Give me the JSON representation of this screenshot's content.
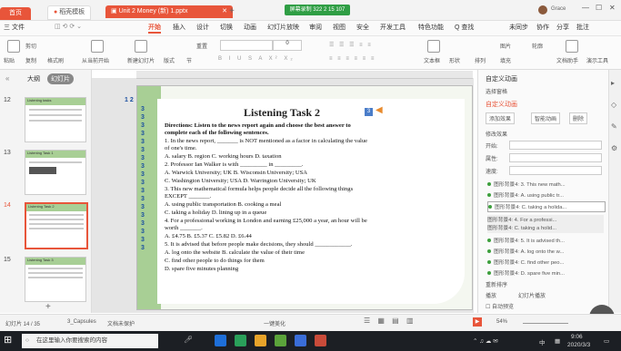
{
  "titlebar": {
    "home_tab": "首页",
    "template_tab": "稻壳模板",
    "doc_tab": "Unit 2 Money (新) 1.pptx",
    "timer": "屏幕录制 322 2 15 107",
    "user": "Grace"
  },
  "menu": {
    "items": [
      "三 文件",
      "开始",
      "插入",
      "设计",
      "切换",
      "动画",
      "幻灯片放映",
      "审阅",
      "视图",
      "安全",
      "开发工具",
      "特色功能",
      "Q 查找"
    ],
    "right": [
      "未同步",
      "协作",
      "分享",
      "批注"
    ]
  },
  "ribbon": {
    "left_buttons": [
      "粘贴",
      "剪切",
      "复制",
      "格式刷",
      "从当前开始",
      "新建幻灯片",
      "版式",
      "节",
      "重置"
    ],
    "font_size": "0",
    "right_buttons": [
      "文本框",
      "形状",
      "排列",
      "图片",
      "填充",
      "轮廓",
      "文档助手",
      "演示工具"
    ]
  },
  "left_panel": {
    "tabs": [
      "大纲",
      "幻灯片"
    ],
    "slide_numbers": [
      "12",
      "13",
      "14",
      "15"
    ],
    "thumb_titles": [
      "Listening tasks",
      "Listening Task 1",
      "Listening Task 2",
      "Listening Task 3"
    ],
    "add_notes": "单击此处添加备注"
  },
  "slide": {
    "number_tag": "1 2",
    "title": "Listening Task 2",
    "badge": "3",
    "lines": [
      "Directions: Listen to the news report again and choose the best answer to",
      "complete each of the following sentences.",
      "1. In the news report, _______ is NOT mentioned as a factor in calculating the value",
      "of one's time.",
      "A. salary              B. region              C. working hours          D. taxation",
      "2. Professor Ian Walker is with _________ in _________.",
      "A. Warwick University; UK         B. Wisconsin University; USA",
      "C. Washington University; USA     D. Warrington University; UK",
      "3. This new mathematical formula helps people decide all the following things",
      "EXCEPT _______.",
      "A. using public transportation         B. cooking a meal",
      "C. taking a holiday                         D. lining up in a queue",
      "4. For a professional working in London and earning £25,000 a year, an hour will be",
      "worth _______.",
      "A. £4.75              B. £5.37              C. £5.82              D. £6.44",
      "5. It is advised that before people make decisions, they should ____________.",
      "A. log onto the website                 B. calculate the value of their time",
      "C. find other people to do things for them",
      "D. spare five minutes planning"
    ],
    "left_numbers": [
      "3",
      "3",
      "3",
      "3",
      "3",
      "3",
      "3",
      "3",
      "3",
      "3",
      "3",
      "3",
      "3",
      "3",
      "3",
      "3",
      "3",
      "3"
    ]
  },
  "right_panel": {
    "title": "自定义动画",
    "select_pane": "选择窗格",
    "custom_anim": "自定义动画",
    "add_effect": "添加效果",
    "smart_anim": "智能动画",
    "delete": "删除",
    "modify": "修改效果",
    "start_label": "开始:",
    "prop_label": "属性:",
    "speed_label": "速度:",
    "items": [
      "图形背景4: 3. This new math...",
      "图形背景4: A. using public tr...",
      "图形背景4: C. taking a holida...",
      "图形背景4: 4. For a professi...",
      "图形背景4: C. taking a holid...",
      "图形背景4: 5. It is advised th...",
      "图形背景4: A. log onto the w...",
      "图形背景4: C. find other peo...",
      "图形背景4: D. spare five min..."
    ],
    "reorder": "重新排序",
    "play": "播放",
    "slideshow": "幻灯片播放",
    "autopreview": "自动预览"
  },
  "statusbar": {
    "slide_count": "幻灯片 14 / 35",
    "theme": "3_Capsules",
    "backup": "文档未保护",
    "beautify": "一键美化",
    "zoom": "54%",
    "zoom_bubble": "46"
  },
  "taskbar": {
    "search_placeholder": "在这里输入你要搜索的内容",
    "time": "9:06",
    "date": "2020/3/3",
    "ime": "中",
    "tray_speed": "0.2K/s"
  }
}
